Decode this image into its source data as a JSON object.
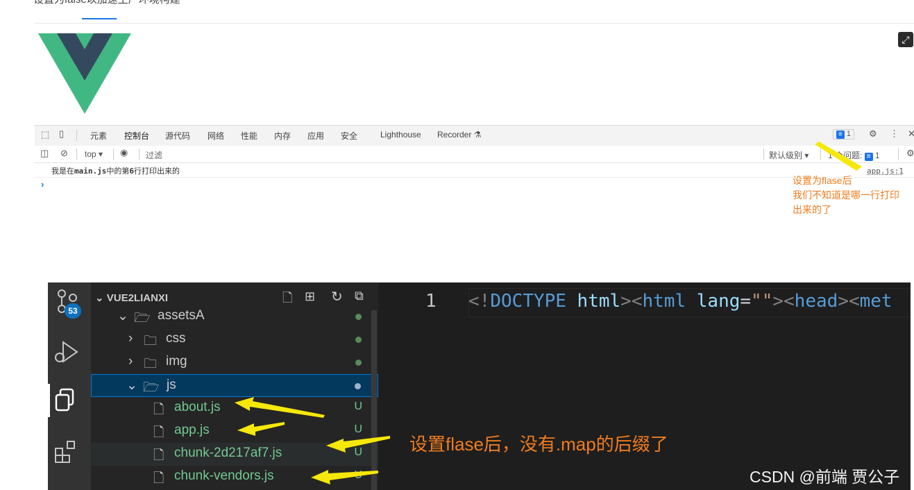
{
  "top_text": "设置为false以加速生产环境构建",
  "devtools": {
    "tabs": [
      "元素",
      "控制台",
      "源代码",
      "网络",
      "性能",
      "内存",
      "应用",
      "安全",
      "Lighthouse",
      "Recorder"
    ],
    "active_tab": "控制台",
    "messages_count": "1",
    "context": "top ▾",
    "filter_placeholder": "过滤",
    "level": "默认级别 ▾",
    "issues_label": "1 个问题:",
    "issues_count": "1",
    "console_prefix": "我是在",
    "console_file": "main.js",
    "console_mid": "中的第",
    "console_line": "6",
    "console_suffix": "行打印出来的",
    "console_source": "app.js:1",
    "prompt": "›"
  },
  "devtools_note": [
    "设置为flase后",
    "我们不知道是哪一行打印",
    "出来的了"
  ],
  "vscode": {
    "activity_badge": "53",
    "explorer_title": "VUE2LIANXI",
    "tree": [
      {
        "label": "assetsA",
        "kind": "folder-open",
        "status": "dot"
      },
      {
        "label": "css",
        "kind": "folder",
        "status": "dot"
      },
      {
        "label": "img",
        "kind": "folder",
        "status": "dot"
      },
      {
        "label": "js",
        "kind": "folder-open",
        "status": "dot",
        "selected": true
      },
      {
        "label": "about.js",
        "kind": "file",
        "status": "U"
      },
      {
        "label": "app.js",
        "kind": "file",
        "status": "U"
      },
      {
        "label": "chunk-2d217af7.js",
        "kind": "file",
        "status": "U"
      },
      {
        "label": "chunk-vendors.js",
        "kind": "file",
        "status": "U"
      }
    ],
    "line_number": "1",
    "code": {
      "lt1": "<!",
      "doctype": "DOCTYPE",
      "html1": "html",
      "mid": "><",
      "html2": "html",
      "lang": "lang",
      "eq": "=",
      "q": "\"\"",
      "gt": "><",
      "head": "head",
      "gt2": "><",
      "met": "met"
    },
    "note": "设置flase后，没有.map的后缀了"
  },
  "watermark": "CSDN @前端 贾公子",
  "colors": {
    "vue_green": "#41b883",
    "vue_dark": "#35495e",
    "arrow_yellow": "#f6e80a",
    "note_orange": "#f07c1e"
  }
}
